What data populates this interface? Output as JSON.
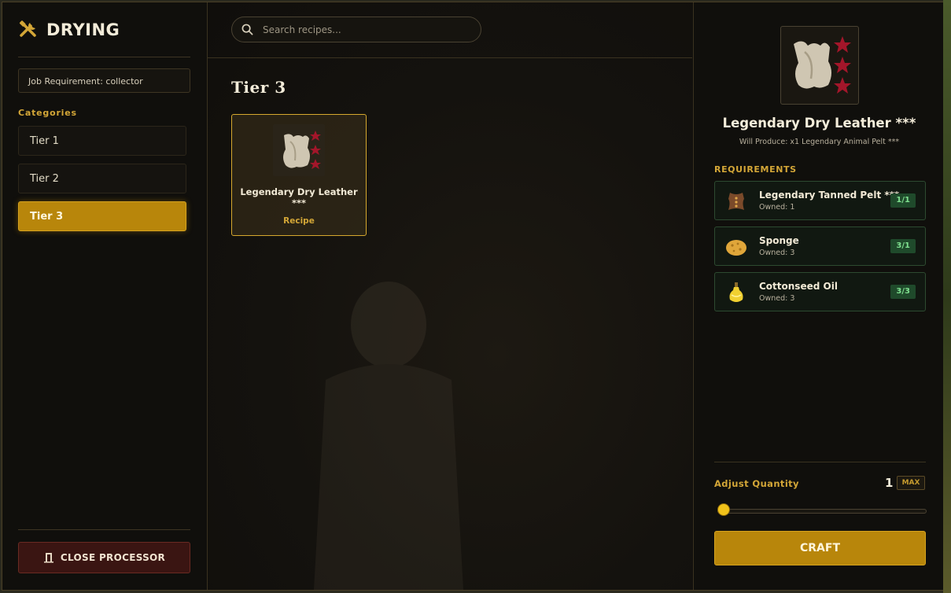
{
  "header": {
    "title": "DRYING"
  },
  "sidebar": {
    "job_requirement": "Job Requirement: collector",
    "categories_label": "Categories",
    "categories": [
      {
        "label": "Tier 1",
        "active": false
      },
      {
        "label": "Tier 2",
        "active": false
      },
      {
        "label": "Tier 3",
        "active": true
      }
    ],
    "close_label": "CLOSE PROCESSOR"
  },
  "main": {
    "search_placeholder": "Search recipes...",
    "section_title": "Tier 3",
    "recipes": [
      {
        "name": "Legendary Dry Leather ***",
        "tag": "Recipe",
        "icon": "animal-pelt-icon",
        "stars": 3
      }
    ]
  },
  "detail": {
    "icon": "animal-pelt-icon",
    "stars": 3,
    "title": "Legendary Dry Leather ***",
    "subtitle": "Will Produce: x1 Legendary Animal Pelt ***",
    "requirements_label": "REQUIREMENTS",
    "requirements": [
      {
        "name": "Legendary Tanned Pelt ***",
        "owned": "Owned: 1",
        "badge": "1/1",
        "icon": "tanned-pelt-icon"
      },
      {
        "name": "Sponge",
        "owned": "Owned: 3",
        "badge": "3/1",
        "icon": "sponge-icon"
      },
      {
        "name": "Cottonseed Oil",
        "owned": "Owned: 3",
        "badge": "3/3",
        "icon": "oil-bottle-icon"
      }
    ],
    "quantity_label": "Adjust Quantity",
    "quantity": "1",
    "max_label": "MAX",
    "slider_value": 0,
    "craft_label": "CRAFT"
  },
  "colors": {
    "accent": "#b8860b",
    "gold_text": "#d3a637",
    "badge_green": "#7fe08f",
    "star_red": "#a3162a",
    "close_red": "#3a1512"
  }
}
